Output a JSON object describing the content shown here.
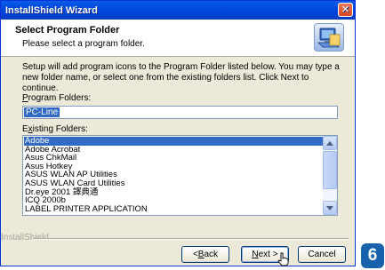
{
  "window": {
    "title": "InstallShield Wizard",
    "close_glyph": "✕"
  },
  "header": {
    "title": "Select Program Folder",
    "subtitle": "Please select a program folder.",
    "icon": "folder-computer-icon"
  },
  "description": "Setup will add program icons to the Program Folder listed below.  You may type a new folder name, or select one from the existing folders list.  Click Next to continue.",
  "program_folders": {
    "label_accel": "P",
    "label_rest": "rogram Folders:",
    "value": "PC-Line"
  },
  "existing_folders": {
    "label_pre": "E",
    "label_accel": "x",
    "label_rest": "isting Folders:",
    "items": [
      "Adobe",
      "Adobe Acrobat",
      "Asus ChkMail",
      "Asus Hotkey",
      "ASUS WLAN AP Utilities",
      "ASUS WLAN Card Utilities",
      "Dr.eye 2001 譯典通",
      "ICQ 2000b",
      "LABEL PRINTER APPLICATION"
    ],
    "selected": "Adobe"
  },
  "footer": {
    "brand": "InstallShield",
    "back": {
      "lt": "< ",
      "accel": "B",
      "rest": "ack"
    },
    "next": {
      "accel": "N",
      "rest": "ext >"
    },
    "cancel": "Cancel"
  },
  "step_badge": "6"
}
